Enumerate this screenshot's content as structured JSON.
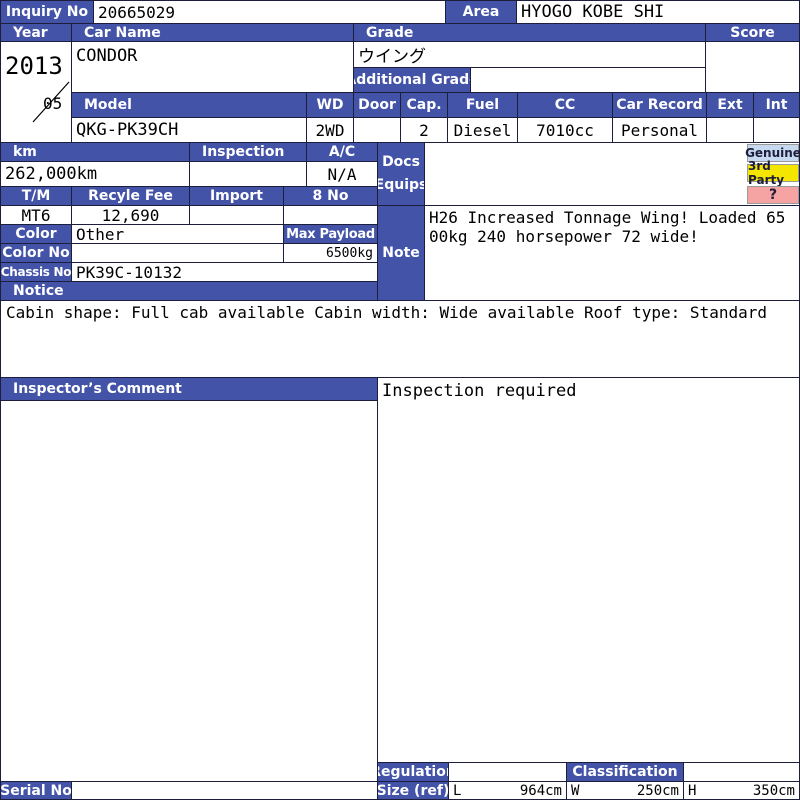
{
  "header": {
    "inquiry_label": "Inquiry No",
    "inquiry_value": "20665029",
    "area_label": "Area",
    "area_value": "HYOGO KOBE SHI"
  },
  "labels": {
    "year": "Year",
    "car_name": "Car Name",
    "grade": "Grade",
    "score": "Score",
    "additional_grade": "Additional Grade",
    "model": "Model",
    "wd": "WD",
    "door": "Door",
    "cap": "Cap.",
    "fuel": "Fuel",
    "cc": "CC",
    "car_record": "Car Record",
    "ext": "Ext",
    "int": "Int",
    "km": "km",
    "inspection": "Inspection",
    "ac": "A/C",
    "docs": "Docs",
    "equips": "Equips",
    "tm": "T/M",
    "recycle_fee": "Recyle Fee",
    "import": "Import",
    "eight_no": "8 No",
    "color": "Color",
    "max_payload": "Max Payload",
    "color_no": "Color No",
    "note": "Note",
    "chassis_no": "Chassis No",
    "notice": "Notice",
    "inspector_comment": "Inspector’s Comment",
    "regulation": "Regulation",
    "size_ref": "Size (ref)",
    "classification": "Classification",
    "serial_no": "Serial No",
    "len": "L",
    "wid": "W",
    "hei": "H"
  },
  "vehicle": {
    "year": "2013",
    "month": "05",
    "car_name": "CONDOR",
    "grade": "ウイング",
    "additional_grade": "",
    "score": "",
    "model": "QKG-PK39CH",
    "wd": "2WD",
    "door": "",
    "cap": "2",
    "fuel": "Diesel",
    "cc": "7010cc",
    "car_record": "Personal",
    "ext": "",
    "int": "",
    "km": "262,000km",
    "inspection": "",
    "ac": "N/A",
    "tm": "MT6",
    "recycle_fee": "12,690",
    "import": "",
    "eight_no": "",
    "color": "Other",
    "color_no": "",
    "max_payload": "6500kg",
    "chassis_no": "PK39C-10132",
    "note": "H26 Increased Tonnage Wing! Loaded 6500kg 240 horsepower 72 wide!",
    "notice": "Cabin shape: Full cab available Cabin width: Wide available Roof type: Standard",
    "inspection_status": "Inspection required",
    "length": "964cm",
    "width": "250cm",
    "height": "350cm",
    "regulation": "",
    "classification": "",
    "serial_no": ""
  },
  "badges": {
    "genuine": "Genuine",
    "third_party": "3rd Party",
    "unknown": "?"
  },
  "colors": {
    "header_bg": "#4353a8",
    "genuine_bg": "#c6d9f0",
    "third_party_bg": "#f5e600",
    "unknown_bg": "#f5a3a3"
  }
}
